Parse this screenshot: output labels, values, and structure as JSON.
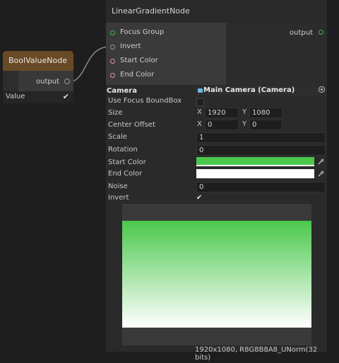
{
  "bool_node": {
    "title": "BoolValueNode",
    "output_label": "output",
    "value_label": "Value",
    "value_checked": true,
    "check_glyph": "✔"
  },
  "gradient_node": {
    "title": "LinearGradientNode",
    "inputs": [
      {
        "label": "Focus Group",
        "port_color": "#4caf50"
      },
      {
        "label": "Invert",
        "port_color": "#9a9a9a"
      },
      {
        "label": "Start Color",
        "port_color": "#e48fa8"
      },
      {
        "label": "End Color",
        "port_color": "#e48fa8"
      }
    ],
    "output_label": "output",
    "output_port_color": "#4caf50",
    "properties": {
      "camera_label": "Camera",
      "camera_value": "Main Camera (Camera)",
      "camera_icon": "camera-icon",
      "use_focus_label": "Use Focus BoundBox",
      "use_focus_checked": false,
      "size_label": "Size",
      "size_x_label": "X",
      "size_x": "1920",
      "size_y_label": "Y",
      "size_y": "1080",
      "center_offset_label": "Center Offset",
      "center_x_label": "X",
      "center_x": "0",
      "center_y_label": "Y",
      "center_y": "0",
      "scale_label": "Scale",
      "scale_value": "1",
      "rotation_label": "Rotation",
      "rotation_value": "0",
      "start_color_label": "Start Color",
      "start_color": "#4bc84c",
      "end_color_label": "End Color",
      "end_color": "#ffffff",
      "noise_label": "Noise",
      "noise_value": "0",
      "invert_label": "Invert",
      "invert_checked": true,
      "check_glyph": "✔"
    },
    "preview": {
      "gradient_top": "#4bc84c",
      "gradient_bottom": "#ffffff",
      "info": "1920x1080, R8G8B8A8_UNorm(32 bits)"
    }
  },
  "colors": {
    "canvas_bg": "#1e1e1e",
    "bool_header": "#694a26",
    "edge": "#8a8a8a"
  }
}
